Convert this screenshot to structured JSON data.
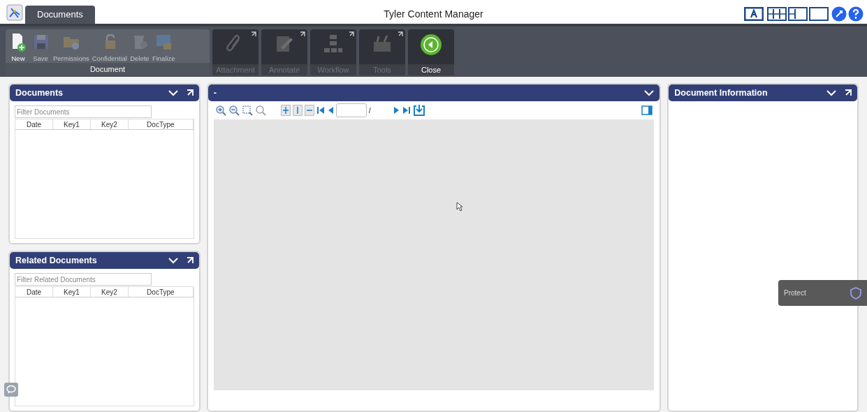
{
  "window": {
    "title": "Tyler Content Manager"
  },
  "tabs": [
    {
      "label": "Documents",
      "selected": true
    }
  ],
  "layouts": [
    {
      "selected": true
    },
    {
      "selected": false
    },
    {
      "selected": false
    },
    {
      "selected": false
    }
  ],
  "ribbon": {
    "groups": [
      {
        "label": "Document",
        "buttons": [
          {
            "label": "New",
            "disabled": false
          },
          {
            "label": "Save",
            "disabled": true
          },
          {
            "label": "Permissions",
            "disabled": true
          },
          {
            "label": "Confidential",
            "disabled": true
          },
          {
            "label": "Delete",
            "disabled": true
          },
          {
            "label": "Finalize",
            "disabled": true
          }
        ]
      },
      {
        "label": "Attachment",
        "disabled": true
      },
      {
        "label": "Annotate",
        "disabled": true
      },
      {
        "label": "Workflow",
        "disabled": true
      },
      {
        "label": "Tools",
        "disabled": true
      },
      {
        "label": "Close",
        "disabled": false
      }
    ]
  },
  "left_panels": [
    {
      "title": "Documents",
      "filter": {
        "placeholder": "Filter Documents"
      },
      "columns": [
        "Date",
        "Key1",
        "Key2",
        "DocType"
      ]
    },
    {
      "title": "Related Documents",
      "filter": {
        "placeholder": "Filter Related Documents"
      },
      "columns": [
        "Date",
        "Key1",
        "Key2",
        "DocType"
      ]
    }
  ],
  "viewer": {
    "title": "-",
    "page_separator": "/"
  },
  "info_panel": {
    "title": "Document Information"
  },
  "protect_popup": {
    "label": "Protect"
  }
}
